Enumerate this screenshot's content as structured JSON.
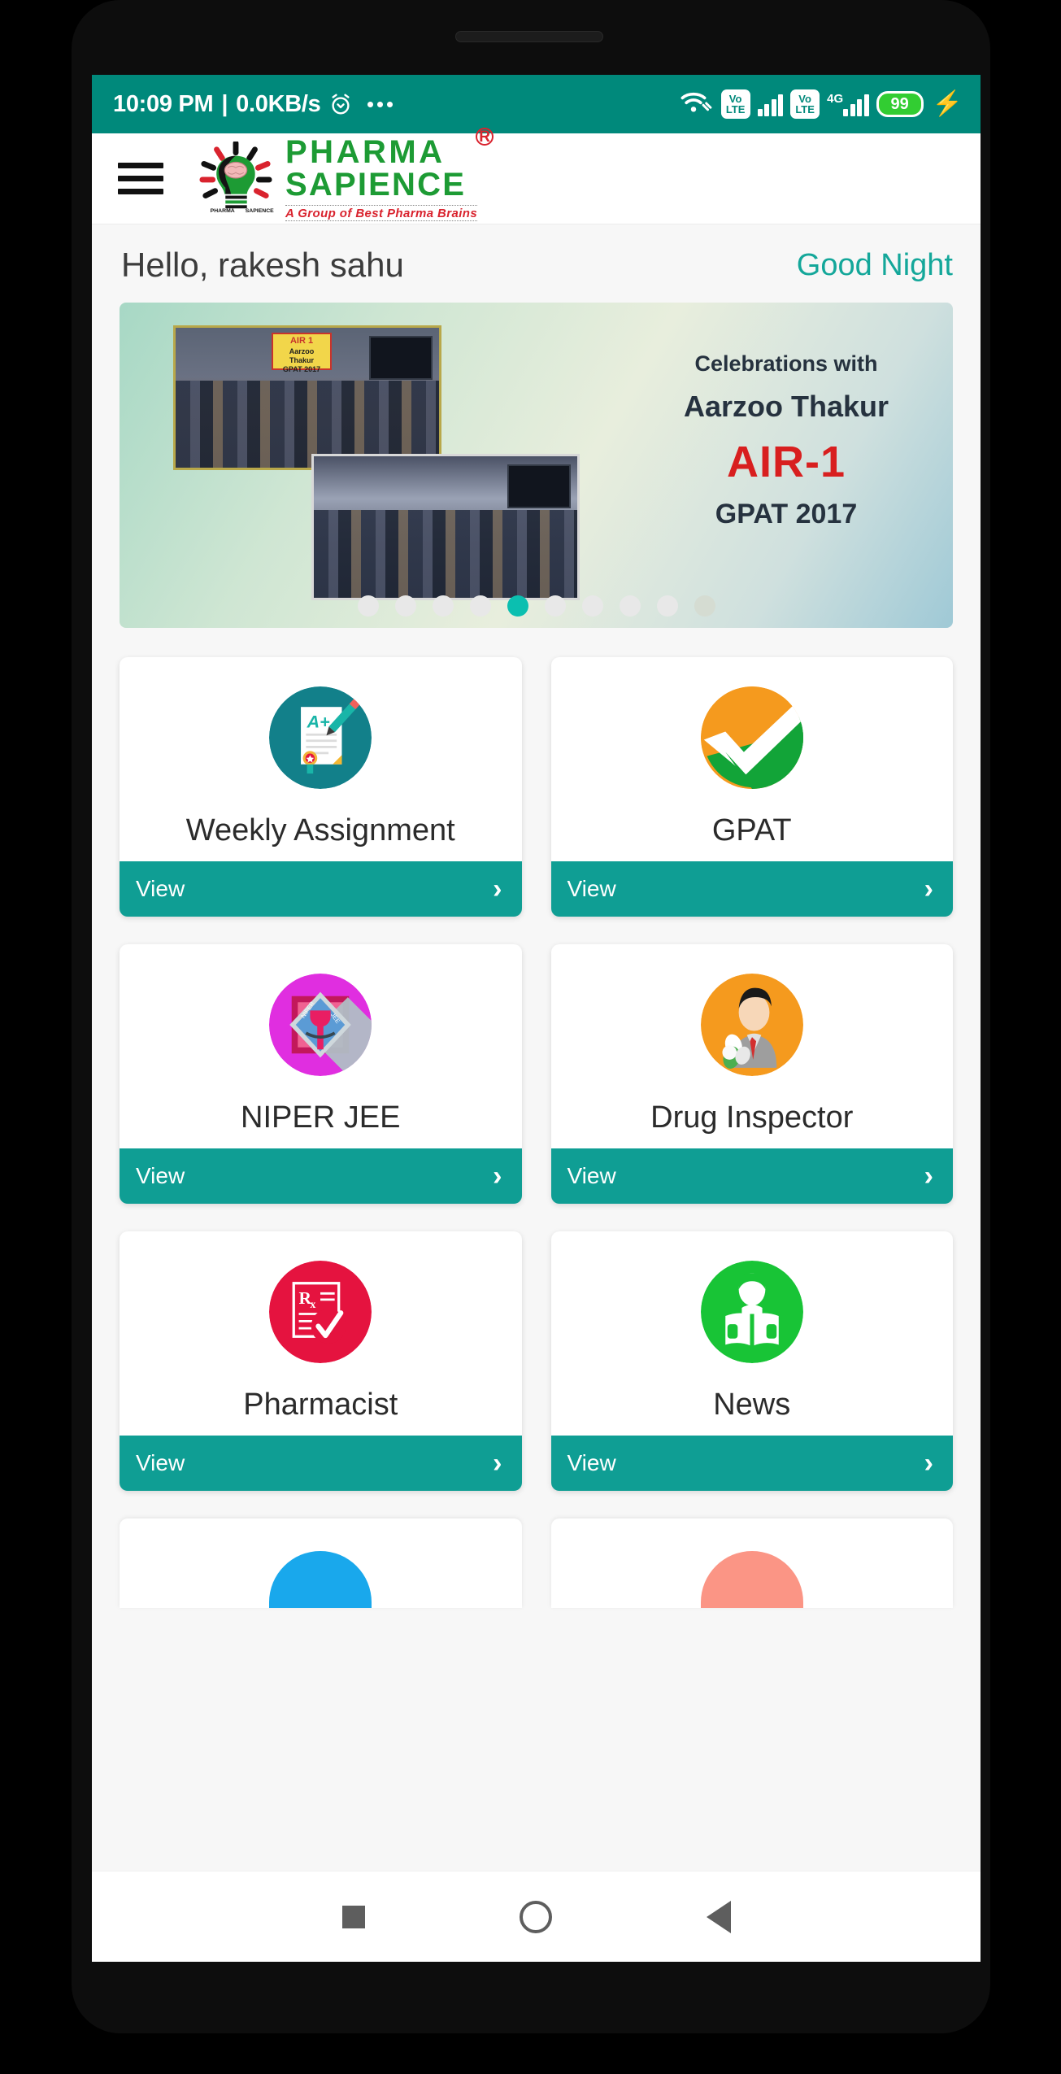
{
  "status_bar": {
    "time": "10:09 PM",
    "separator": "|",
    "network_speed": "0.0KB/s",
    "alarm_icon": "alarm-clock-icon",
    "more_icon": "more-dots-icon",
    "wifi_icon": "wifi-icon",
    "volte_label_top": "Vo",
    "volte_label_bottom": "LTE",
    "network_type": "4G",
    "battery_level": "99",
    "charging_icon": "charging-bolt-icon",
    "bg_color": "#00897b"
  },
  "app_bar": {
    "menu_icon": "hamburger-menu-icon",
    "logo_line1": "PHARMA",
    "logo_line2": "SAPIENCE",
    "logo_registered": "R",
    "logo_tagline": "A Group of Best Pharma Brains",
    "logo_brand_color": "#1d9b34",
    "logo_tagline_color": "#d9232e"
  },
  "greeting": {
    "hello": "Hello, rakesh sahu",
    "time_of_day": "Good Night",
    "time_of_day_color": "#14a79a"
  },
  "banner": {
    "line1": "Celebrations with",
    "line2": "Aarzoo Thakur",
    "line3": "AIR-1",
    "line4": "GPAT 2017",
    "air_badge_line1": "AIR 1",
    "air_badge_line2": "Aarzoo",
    "air_badge_line3": "Thakur",
    "air_badge_line4": "GPAT 2017",
    "highlight_color": "#d81f1f",
    "total_dots": 10,
    "active_dot_index": 4
  },
  "cards": [
    {
      "title": "Weekly Assignment",
      "view_label": "View",
      "icon": "assignment-a-plus-icon",
      "icon_bg": "#12808a",
      "chevron": "›"
    },
    {
      "title": "GPAT",
      "view_label": "View",
      "icon": "gpat-checkmark-icon",
      "icon_bg": "#f59a1e",
      "chevron": "›"
    },
    {
      "title": "NIPER JEE",
      "view_label": "View",
      "icon": "niper-jee-emblem-icon",
      "icon_bg": "#e02ee0",
      "chevron": "›"
    },
    {
      "title": "Drug Inspector",
      "view_label": "View",
      "icon": "drug-inspector-person-icon",
      "icon_bg": "#f59a1e",
      "chevron": "›"
    },
    {
      "title": "Pharmacist",
      "view_label": "View",
      "icon": "pharmacist-rx-icon",
      "icon_bg": "#e5133f",
      "chevron": "›"
    },
    {
      "title": "News",
      "view_label": "View",
      "icon": "news-reader-icon",
      "icon_bg": "#18c436",
      "chevron": "›"
    }
  ],
  "partial_cards": [
    {
      "icon": "partial-blue-icon",
      "icon_bg": "#19a8ec"
    },
    {
      "icon": "partial-salmon-icon",
      "icon_bg": "#fb9585"
    }
  ],
  "nav_bar": {
    "recents_icon": "square-recents-icon",
    "home_icon": "circle-home-icon",
    "back_icon": "triangle-back-icon"
  },
  "theme": {
    "primary": "#0f9e94",
    "status_bar": "#00897b",
    "page_bg": "#f7f7f7"
  }
}
